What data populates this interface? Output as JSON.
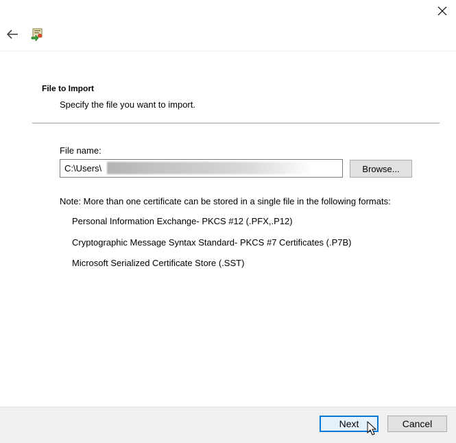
{
  "window": {
    "close_icon": "close-icon",
    "back_icon": "back-arrow-icon",
    "wizard_icon": "certificate-import-icon"
  },
  "section": {
    "title": "File to Import",
    "subtitle": "Specify the file you want to import."
  },
  "file": {
    "label": "File name:",
    "value": "C:\\Users\\",
    "browse_label": "Browse..."
  },
  "note": "Note:  More than one certificate can be stored in a single file in the following formats:",
  "formats": [
    "Personal Information Exchange- PKCS #12 (.PFX,.P12)",
    "Cryptographic Message Syntax Standard- PKCS #7 Certificates (.P7B)",
    "Microsoft Serialized Certificate Store (.SST)"
  ],
  "footer": {
    "next_label": "Next",
    "cancel_label": "Cancel"
  },
  "colors": {
    "accent": "#0078d7",
    "footer_bg": "#f0f0f0"
  }
}
